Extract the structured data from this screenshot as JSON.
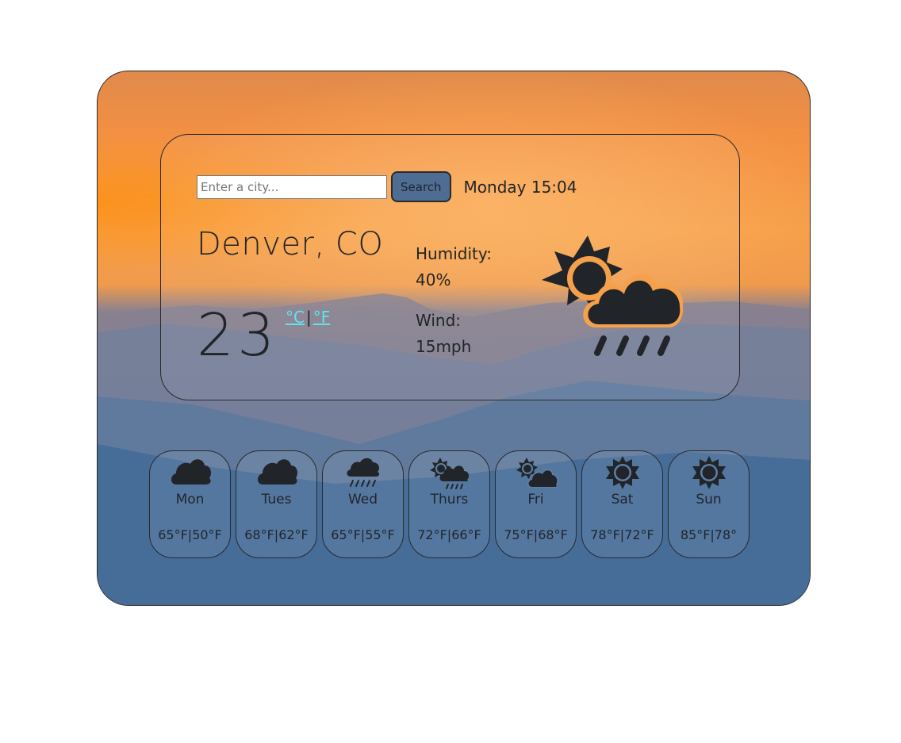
{
  "search": {
    "placeholder": "Enter a city...",
    "value": "",
    "button_label": "Search"
  },
  "datetime": "Monday 15:04",
  "current": {
    "city": "Denver, CO",
    "temperature": "23",
    "unit_celsius": "°C",
    "unit_separator": "|",
    "unit_fahrenheit": "°F",
    "humidity_label": "Humidity:",
    "humidity_value": "40%",
    "wind_label": "Wind:",
    "wind_value": "15mph",
    "icon": "sun-cloud-rain-icon"
  },
  "forecast": [
    {
      "day": "Mon",
      "range": "65°F|50°F",
      "icon": "cloud-icon"
    },
    {
      "day": "Tues",
      "range": "68°F|62°F",
      "icon": "cloud-icon"
    },
    {
      "day": "Wed",
      "range": "65°F|55°F",
      "icon": "cloud-rain-icon"
    },
    {
      "day": "Thurs",
      "range": "72°F|66°F",
      "icon": "sun-cloud-rain-icon"
    },
    {
      "day": "Fri",
      "range": "75°F|68°F",
      "icon": "sun-cloud-icon"
    },
    {
      "day": "Sat",
      "range": "78°F|72°F",
      "icon": "sun-icon"
    },
    {
      "day": "Sun",
      "range": "85°F|78°",
      "icon": "sun-icon"
    }
  ],
  "colors": {
    "accent_link": "#5ee6f0",
    "button_bg": "#4f6d92",
    "text": "#212529"
  }
}
